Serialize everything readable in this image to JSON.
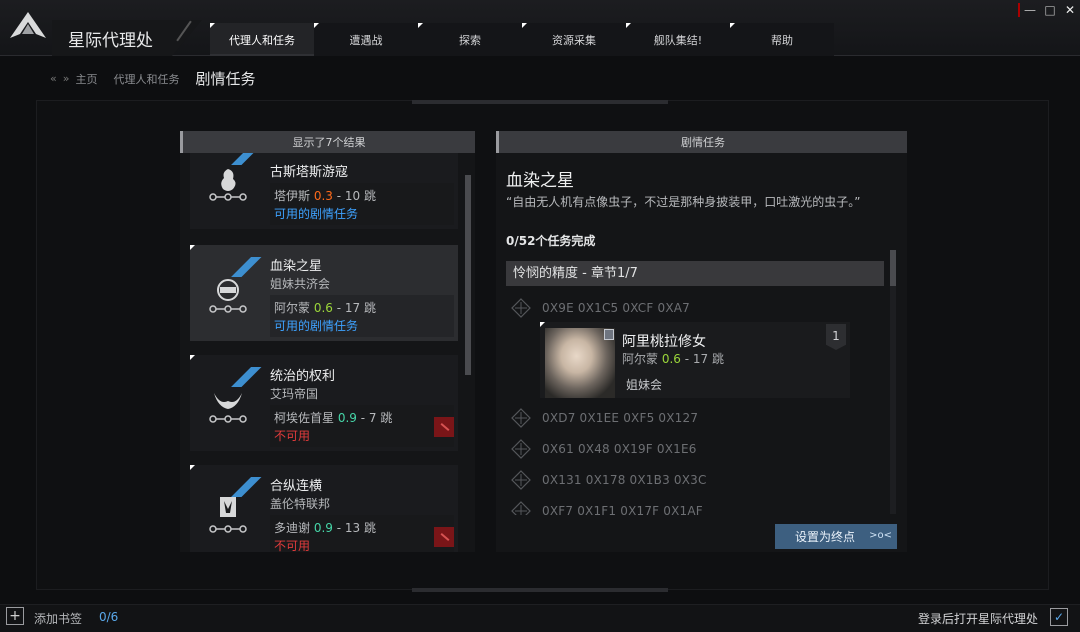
{
  "app": {
    "title": "星际代理处"
  },
  "window_controls": {
    "minimize": "—",
    "maximize": "□",
    "close": "✕"
  },
  "tabs": [
    {
      "label": "代理人和任务",
      "active": true
    },
    {
      "label": "遭遇战"
    },
    {
      "label": "探索"
    },
    {
      "label": "资源采集"
    },
    {
      "label": "舰队集结!"
    },
    {
      "label": "帮助"
    }
  ],
  "breadcrumb": {
    "back": "«",
    "forward": "»",
    "items": [
      "主页",
      "代理人和任务"
    ],
    "current": "剧情任务"
  },
  "left_panel": {
    "header": "显示了7个结果",
    "items": [
      {
        "name": "古斯塔斯游寇",
        "faction": "",
        "system": "塔伊斯",
        "security": "0.3",
        "jumps": "- 10 跳",
        "status": "可用的剧情任务",
        "available": true
      },
      {
        "name": "血染之星",
        "faction": "姐妹共济会",
        "system": "阿尔蒙",
        "security": "0.6",
        "jumps": "- 17 跳",
        "status": "可用的剧情任务",
        "available": true,
        "selected": true
      },
      {
        "name": "统治的权利",
        "faction": "艾玛帝国",
        "system": "柯埃佐首星",
        "security": "0.9",
        "jumps": "- 7 跳",
        "status": "不可用",
        "available": false
      },
      {
        "name": "合纵连横",
        "faction": "盖伦特联邦",
        "system": "多迪谢",
        "security": "0.9",
        "jumps": "- 13 跳",
        "status": "不可用",
        "available": false
      }
    ]
  },
  "right_panel": {
    "header": "剧情任务",
    "title": "血染之星",
    "description": "“自由无人机有点像虫子，不过是那种身披装甲，口吐激光的虫子。”",
    "progress": "0/52个任务完成",
    "chapter": "怜悯的精度 - 章节1/7",
    "steps": [
      "0X9E 0X1C5 0XCF 0XA7",
      "0XD7 0X1EE 0XF5 0X127",
      "0X61 0X48 0X19F 0X1E6",
      "0X131 0X178 0X1B3 0X3C",
      "0XF7 0X1F1 0X17F 0X1AF"
    ],
    "agent": {
      "name": "阿里桃拉修女",
      "system": "阿尔蒙",
      "security": "0.6",
      "jumps": "- 17 跳",
      "corp": "姐妹会",
      "level": "1"
    },
    "set_destination": "设置为终点",
    "set_destination_icon": ">o<"
  },
  "bottom": {
    "add_icon": "+",
    "bookmark_label": "添加书签",
    "bookmark_count": "0/6",
    "login_label": "登录后打开星际代理处",
    "login_check": "✓"
  },
  "colors": {
    "available": "#3ea2ff",
    "unavailable": "#e23b3b",
    "sec_low": "#ff6a1a",
    "sec_mid": "#9bd63a",
    "sec_high": "#46d6a8",
    "accent": "#3d5f80"
  }
}
